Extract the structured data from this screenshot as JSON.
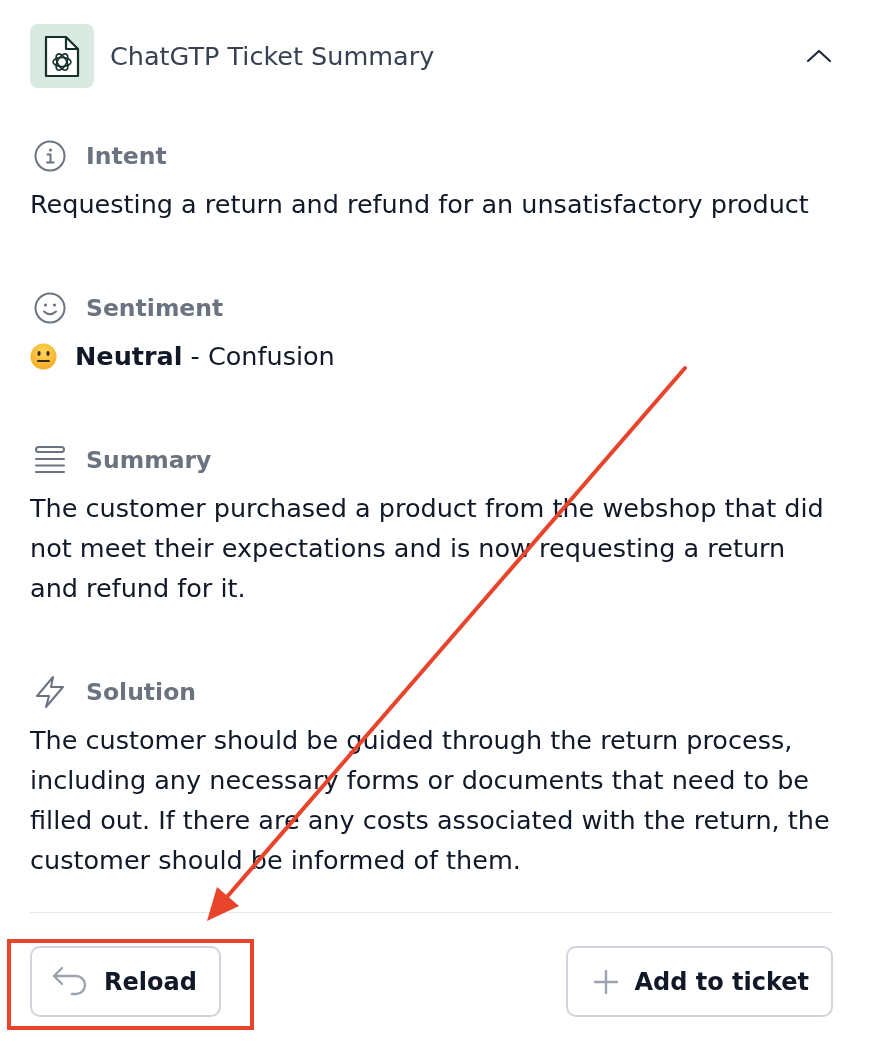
{
  "header": {
    "title": "ChatGTP Ticket Summary",
    "expanded": true
  },
  "sections": [
    {
      "kind": "intent",
      "heading": "Intent",
      "text": "Requesting a return and refund for an unsatisfactory product"
    },
    {
      "kind": "sentiment",
      "heading": "Sentiment",
      "text": "**Neutral** - Confusion"
    },
    {
      "kind": "summary",
      "heading": "Summary",
      "text": "The customer purchased a product from the webshop that did not meet their expectations and is now requesting a return and refund for it."
    },
    {
      "kind": "solution",
      "heading": "Solution",
      "text": "The customer should be guided through the return process, including any necessary forms or documents that need to be filled out. If there are any costs associated with the return, the customer should be informed of them."
    }
  ],
  "buttons": [
    {
      "kind": "reload",
      "label": "Reload",
      "highlighted": true
    },
    {
      "kind": "add",
      "label": "Add to ticket",
      "highlighted": false
    }
  ]
}
